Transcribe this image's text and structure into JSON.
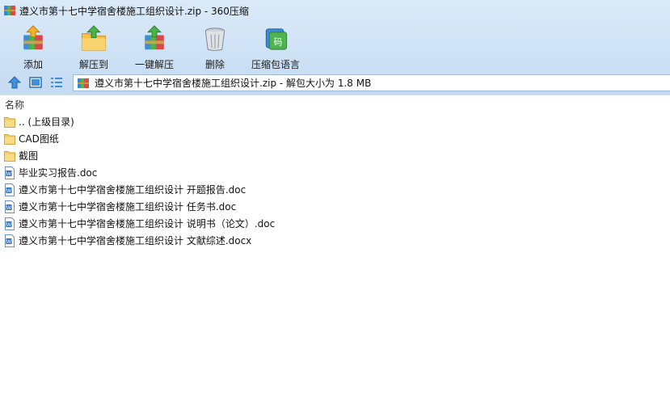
{
  "window": {
    "title": "遵义市第十七中学宿舍楼施工组织设计.zip - 360压缩"
  },
  "toolbar": {
    "add_label": "添加",
    "extract_to_label": "解压到",
    "one_click_extract_label": "一键解压",
    "delete_label": "删除",
    "comment_label": "压缩包语言"
  },
  "address": {
    "path": "遵义市第十七中学宿舍楼施工组织设计.zip - 解包大小为 1.8 MB"
  },
  "list": {
    "header_name": "名称",
    "items": [
      {
        "name": ".. (上级目录)",
        "type": "folder"
      },
      {
        "name": "CAD图纸",
        "type": "folder"
      },
      {
        "name": "截图",
        "type": "folder"
      },
      {
        "name": "毕业实习报告.doc",
        "type": "doc"
      },
      {
        "name": "遵义市第十七中学宿舍楼施工组织设计 开题报告.doc",
        "type": "doc"
      },
      {
        "name": "遵义市第十七中学宿舍楼施工组织设计 任务书.doc",
        "type": "doc"
      },
      {
        "name": "遵义市第十七中学宿舍楼施工组织设计 说明书（论文）.doc",
        "type": "doc"
      },
      {
        "name": "遵义市第十七中学宿舍楼施工组织设计 文献综述.docx",
        "type": "doc"
      }
    ]
  },
  "colors": {
    "chrome": "#cfe2f5",
    "folder": "#f5cf6b",
    "doc_blue": "#2f6fc0"
  }
}
